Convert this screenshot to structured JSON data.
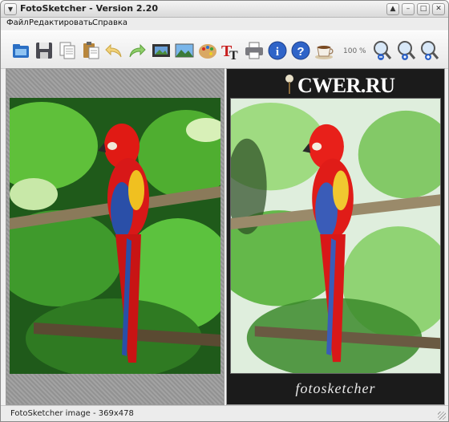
{
  "window": {
    "title": "FotoSketcher - Version 2.20",
    "buttons": [
      "collapse",
      "minimize",
      "maximize",
      "close"
    ]
  },
  "menubar": {
    "items": [
      "Файл",
      "Редактировать",
      "Справка"
    ]
  },
  "toolbar": {
    "icons": [
      "open-folder-icon",
      "save-icon",
      "copy-icon",
      "paste-icon",
      "undo-icon",
      "redo-icon",
      "filmstrip-icon",
      "landscape-icon",
      "palette-icon",
      "text-icon",
      "print-icon",
      "info-icon",
      "help-icon",
      "coffee-icon",
      "zoom-out-icon",
      "zoom-100-icon",
      "zoom-in-icon"
    ],
    "zoom_label": "100 %"
  },
  "panes": {
    "right": {
      "logo_text": "CWER.RU",
      "signature": "fotosketcher"
    }
  },
  "status": {
    "text": "FotoSketcher image - 369x478"
  },
  "colors": {
    "parrot_red": "#d81818",
    "parrot_blue": "#2a4fa8",
    "foliage": "#3f9a2c",
    "frame_dark": "#1b1b1b"
  }
}
